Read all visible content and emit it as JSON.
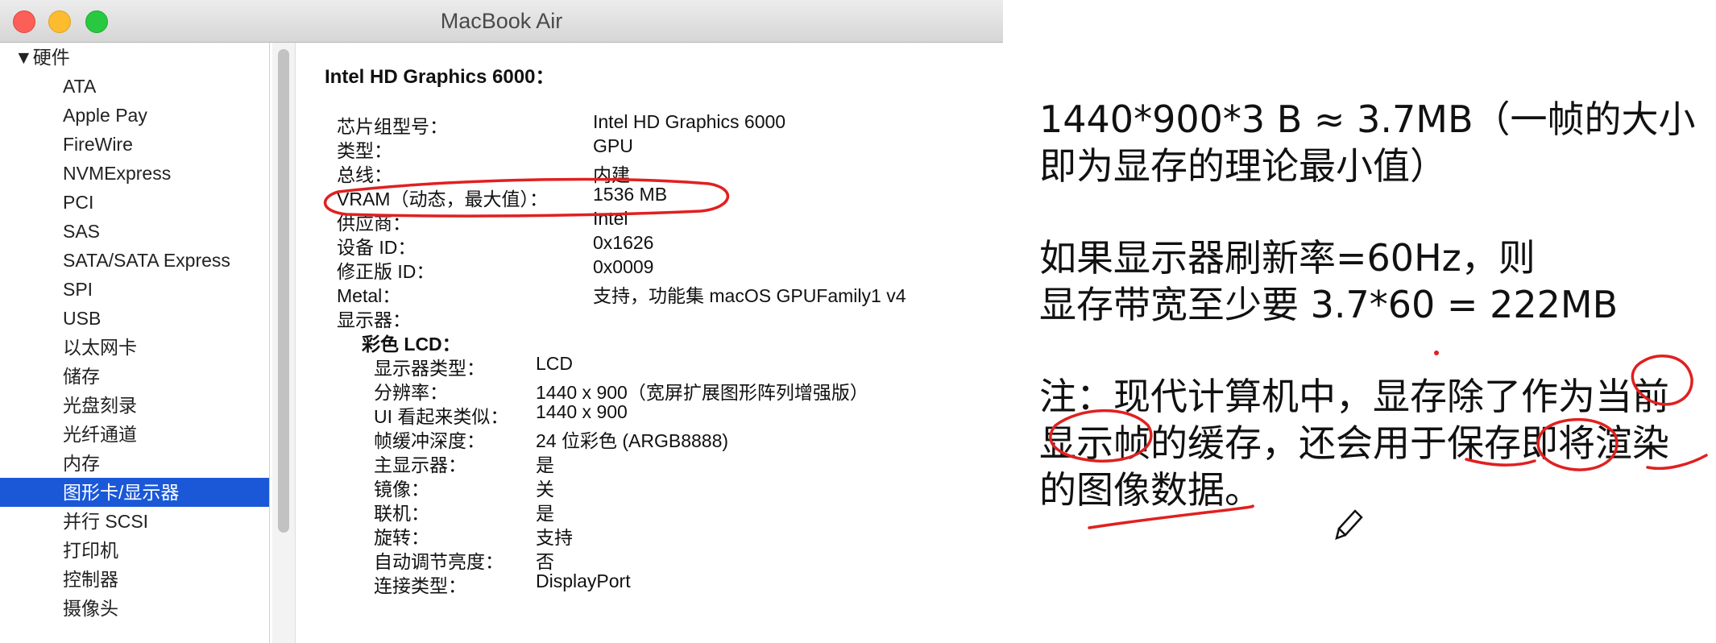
{
  "window": {
    "title": "MacBook Air"
  },
  "sidebar": {
    "section": "▼硬件",
    "items": [
      "ATA",
      "Apple Pay",
      "FireWire",
      "NVMExpress",
      "PCI",
      "SAS",
      "SATA/SATA Express",
      "SPI",
      "USB",
      "以太网卡",
      "储存",
      "光盘刻录",
      "光纤通道",
      "内存",
      "图形卡/显示器",
      "并行 SCSI",
      "打印机",
      "控制器",
      "摄像头"
    ],
    "selected_index": 14
  },
  "detail": {
    "heading": "Intel HD Graphics 6000：",
    "rows": [
      {
        "label": "芯片组型号：",
        "value": "Intel HD Graphics 6000"
      },
      {
        "label": "类型：",
        "value": "GPU"
      },
      {
        "label": "总线：",
        "value": "内建"
      },
      {
        "label": "VRAM（动态，最大值）：",
        "value": "1536 MB"
      },
      {
        "label": "供应商：",
        "value": "Intel"
      },
      {
        "label": "设备 ID：",
        "value": "0x1626"
      },
      {
        "label": "修正版 ID：",
        "value": "0x0009"
      },
      {
        "label": "Metal：",
        "value": "支持，功能集 macOS GPUFamily1 v4"
      },
      {
        "label": "显示器：",
        "value": ""
      }
    ],
    "display_heading": "彩色 LCD：",
    "display_rows": [
      {
        "label": "显示器类型：",
        "value": "LCD"
      },
      {
        "label": "分辨率：",
        "value": "1440 x 900（宽屏扩展图形阵列增强版）"
      },
      {
        "label": "UI 看起来类似：",
        "value": "1440 x 900"
      },
      {
        "label": "帧缓冲深度：",
        "value": "24 位彩色 (ARGB8888)"
      },
      {
        "label": "主显示器：",
        "value": "是"
      },
      {
        "label": "镜像：",
        "value": "关"
      },
      {
        "label": "联机：",
        "value": "是"
      },
      {
        "label": "旋转：",
        "value": "支持"
      },
      {
        "label": "自动调节亮度：",
        "value": "否"
      },
      {
        "label": "连接类型：",
        "value": "DisplayPort"
      }
    ]
  },
  "notes": {
    "line1": "1440*900*3 B ≈ 3.7MB（一帧的大小",
    "line2": "即为显存的理论最小值）",
    "line3": "如果显示器刷新率=60Hz，则",
    "line4": "显存带宽至少要 3.7*60 = 222MB",
    "line5": "注：现代计算机中，显存除了作为当前",
    "line6": "显示帧的缓存，还会用于保存即将渲染",
    "line7": "的图像数据。"
  },
  "colors": {
    "selection": "#1b58d8",
    "ink": "#e02020"
  }
}
